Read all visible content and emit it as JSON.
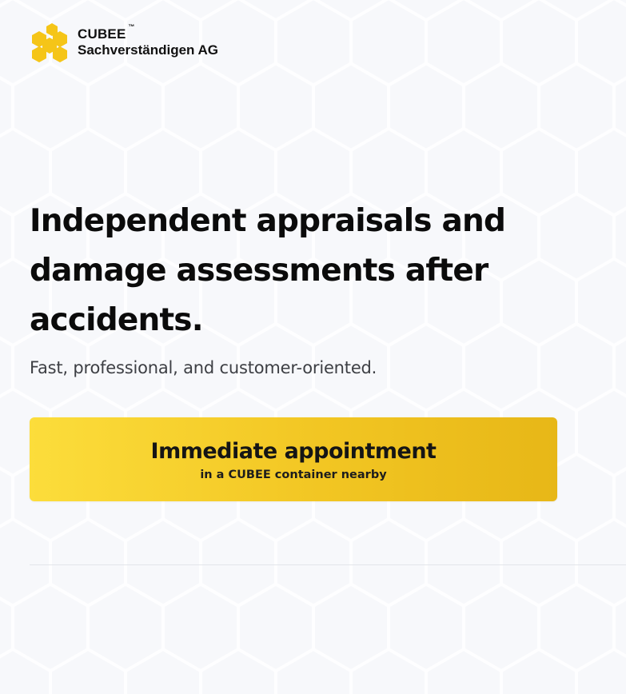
{
  "brand": {
    "name": "CUBEE",
    "trademark": "™",
    "subtitle": "Sachverständigen AG",
    "logo_icon": "honeycomb-logo-icon",
    "accent_color": "#f5c518"
  },
  "hero": {
    "headline": "Independent appraisals and damage assessments after accidents.",
    "subline": "Fast, professional, and customer-oriented."
  },
  "cta": {
    "title": "Immediate appointment",
    "subtitle": "in a CUBEE container nearby"
  },
  "colors": {
    "background": "#f7f8fb",
    "cta_gradient_start": "#fcdd3b",
    "cta_gradient_end": "#e7b717",
    "text": "#0b0b0b"
  }
}
